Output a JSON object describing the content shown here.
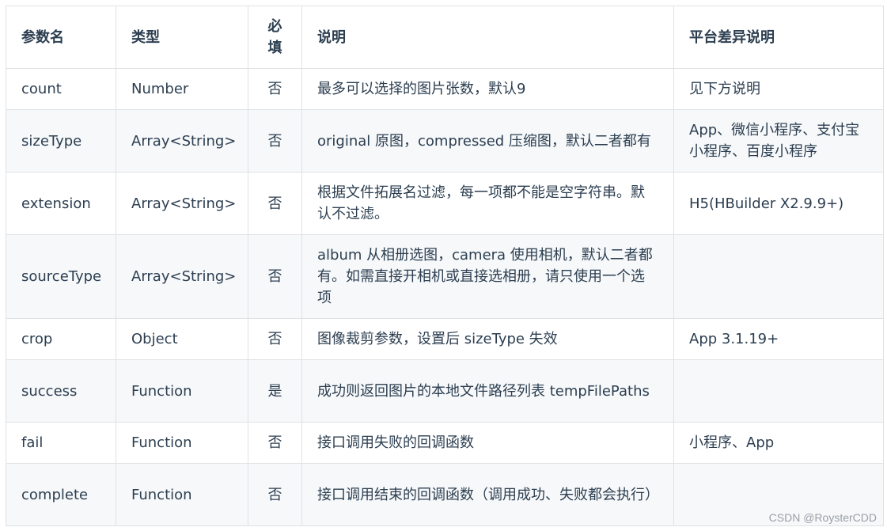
{
  "headers": {
    "name": "参数名",
    "type": "类型",
    "required_line1": "必",
    "required_line2": "填",
    "desc": "说明",
    "platform": "平台差异说明"
  },
  "rows": [
    {
      "name": "count",
      "type": "Number",
      "required": "否",
      "desc": "最多可以选择的图片张数，默认9",
      "platform": "见下方说明"
    },
    {
      "name": "sizeType",
      "type": "Array<String>",
      "required": "否",
      "desc": "original 原图，compressed 压缩图，默认二者都有",
      "platform": "App、微信小程序、支付宝小程序、百度小程序"
    },
    {
      "name": "extension",
      "type": "Array<String>",
      "required": "否",
      "desc": "根据文件拓展名过滤，每一项都不能是空字符串。默认不过滤。",
      "platform": "H5(HBuilder X2.9.9+)"
    },
    {
      "name": "sourceType",
      "type": "Array<String>",
      "required": "否",
      "desc": "album 从相册选图，camera 使用相机，默认二者都有。如需直接开相机或直接选相册，请只使用一个选项",
      "platform": ""
    },
    {
      "name": "crop",
      "type": "Object",
      "required": "否",
      "desc": "图像裁剪参数，设置后 sizeType 失效",
      "platform": "App 3.1.19+"
    },
    {
      "name": "success",
      "type": "Function",
      "required": "是",
      "desc": "成功则返回图片的本地文件路径列表 tempFilePaths",
      "platform": ""
    },
    {
      "name": "fail",
      "type": "Function",
      "required": "否",
      "desc": "接口调用失败的回调函数",
      "platform": "小程序、App"
    },
    {
      "name": "complete",
      "type": "Function",
      "required": "否",
      "desc": "接口调用结束的回调函数（调用成功、失败都会执行）",
      "platform": ""
    }
  ],
  "watermark": "CSDN @RoysterCDD"
}
